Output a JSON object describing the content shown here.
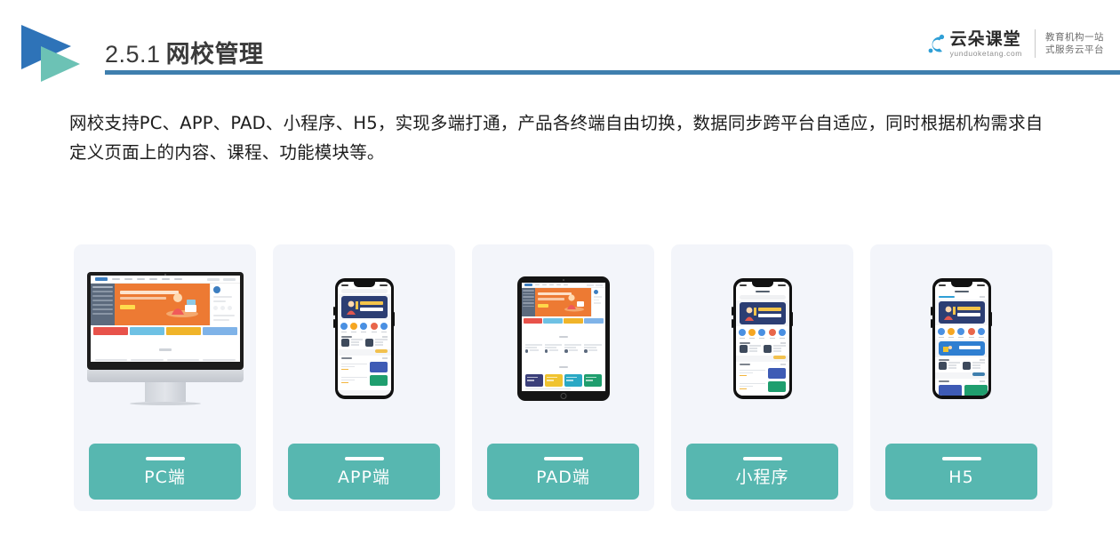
{
  "header": {
    "section_number": "2.5.1",
    "section_title": "网校管理",
    "logo_icon": "double-arrow-logo",
    "rule_color": "#3f7fae"
  },
  "brand": {
    "cloud_icon": "cloud-icon",
    "name_cn": "云朵课堂",
    "name_en": "yunduoketang.com",
    "tagline_line1": "教育机构一站",
    "tagline_line2": "式服务云平台"
  },
  "body": {
    "paragraph": "网校支持PC、APP、PAD、小程序、H5，实现多端打通，产品各终端自由切换，数据同步跨平台自适应，同时根据机构需求自定义页面上的内容、课程、功能模块等。"
  },
  "cards": [
    {
      "label": "PC端",
      "device": "desktop-monitor",
      "accent": "#57b7b0"
    },
    {
      "label": "APP端",
      "device": "smartphone",
      "accent": "#57b7b0"
    },
    {
      "label": "PAD端",
      "device": "tablet",
      "accent": "#57b7b0"
    },
    {
      "label": "小程序",
      "device": "smartphone",
      "accent": "#57b7b0"
    },
    {
      "label": "H5",
      "device": "smartphone",
      "accent": "#57b7b0"
    }
  ],
  "colors": {
    "teal": "#57b7b0",
    "blue": "#3f7fae",
    "logo_blue": "#2e73b8",
    "logo_teal": "#6cc2b5",
    "card_bg": "#f3f5fa",
    "text": "#1c1c1c"
  }
}
